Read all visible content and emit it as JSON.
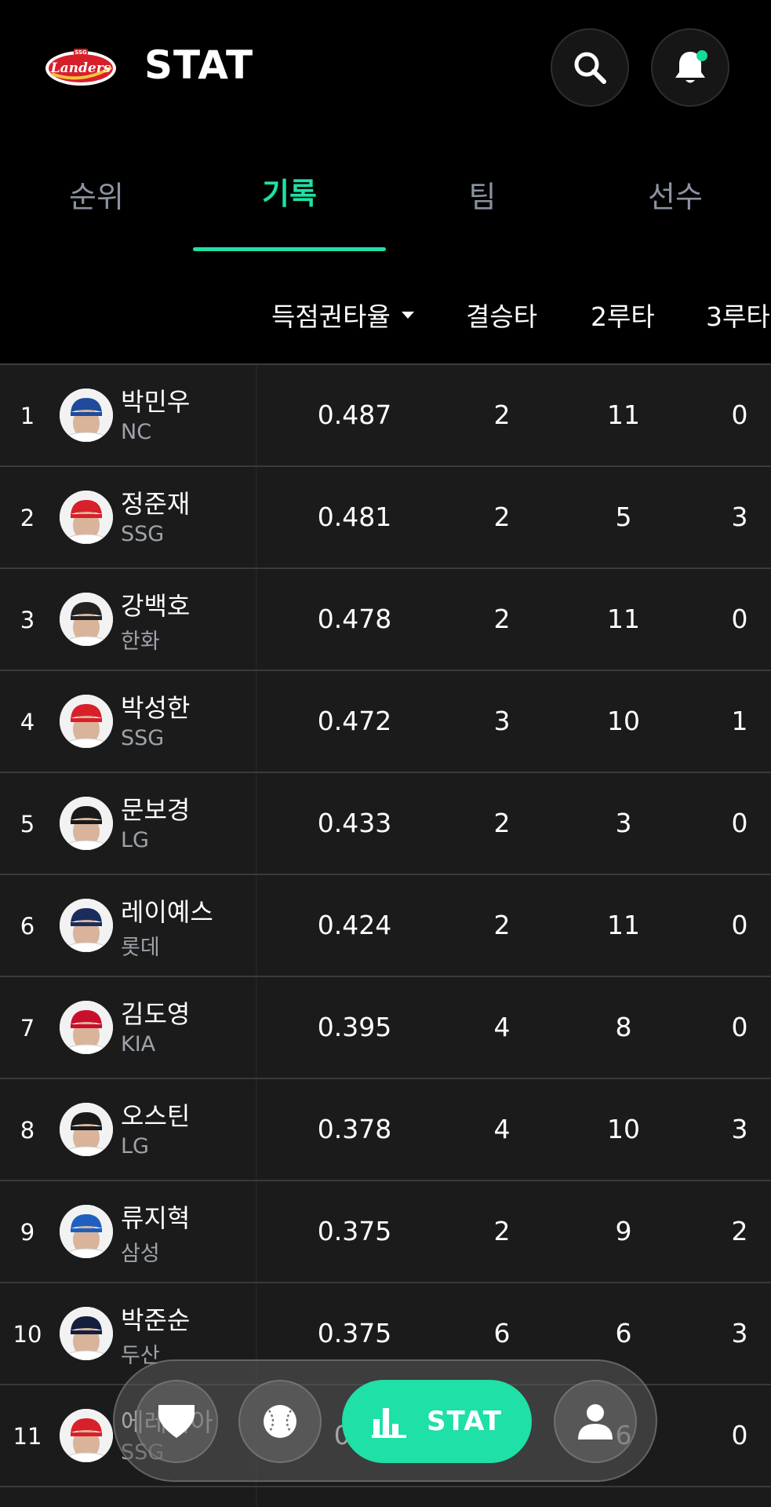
{
  "header": {
    "logo_text": "SSG Landers",
    "title": "STAT"
  },
  "tabs": [
    {
      "label": "순위",
      "active": false
    },
    {
      "label": "기록",
      "active": true
    },
    {
      "label": "팀",
      "active": false
    },
    {
      "label": "선수",
      "active": false
    }
  ],
  "columns": {
    "sorted": "득점권타율",
    "c2": "결승타",
    "c3": "2루타",
    "c4": "3루타"
  },
  "rows": [
    {
      "rank": "1",
      "name": "박민우",
      "team": "NC",
      "v1": "0.487",
      "v2": "2",
      "v3": "11",
      "v4": "0",
      "cap_color": "#1f4b9a"
    },
    {
      "rank": "2",
      "name": "정준재",
      "team": "SSG",
      "v1": "0.481",
      "v2": "2",
      "v3": "5",
      "v4": "3",
      "cap_color": "#d8202a"
    },
    {
      "rank": "3",
      "name": "강백호",
      "team": "한화",
      "v1": "0.478",
      "v2": "2",
      "v3": "11",
      "v4": "0",
      "cap_color": "#222222"
    },
    {
      "rank": "4",
      "name": "박성한",
      "team": "SSG",
      "v1": "0.472",
      "v2": "3",
      "v3": "10",
      "v4": "1",
      "cap_color": "#d8202a"
    },
    {
      "rank": "5",
      "name": "문보경",
      "team": "LG",
      "v1": "0.433",
      "v2": "2",
      "v3": "3",
      "v4": "0",
      "cap_color": "#1a1a1a"
    },
    {
      "rank": "6",
      "name": "레이예스",
      "team": "롯데",
      "v1": "0.424",
      "v2": "2",
      "v3": "11",
      "v4": "0",
      "cap_color": "#1b2d5c"
    },
    {
      "rank": "7",
      "name": "김도영",
      "team": "KIA",
      "v1": "0.395",
      "v2": "4",
      "v3": "8",
      "v4": "0",
      "cap_color": "#c8102e"
    },
    {
      "rank": "8",
      "name": "오스틴",
      "team": "LG",
      "v1": "0.378",
      "v2": "4",
      "v3": "10",
      "v4": "3",
      "cap_color": "#1a1a1a"
    },
    {
      "rank": "9",
      "name": "류지혁",
      "team": "삼성",
      "v1": "0.375",
      "v2": "2",
      "v3": "9",
      "v4": "2",
      "cap_color": "#1f5fbf"
    },
    {
      "rank": "10",
      "name": "박준순",
      "team": "두산",
      "v1": "0.375",
      "v2": "6",
      "v3": "6",
      "v4": "3",
      "cap_color": "#131f3d"
    },
    {
      "rank": "11",
      "name": "에레디아",
      "team": "SSG",
      "v1": "0.3",
      "v2": "",
      "v3": "6",
      "v4": "0",
      "cap_color": "#d8202a"
    }
  ],
  "bottom_nav": {
    "heart_icon": "heart-icon",
    "ball_icon": "baseball-icon",
    "stat_label": "STAT",
    "user_icon": "user-icon"
  },
  "colors": {
    "accent": "#1fe0a6",
    "background": "#000000",
    "table_bg": "#1b1b1b"
  }
}
